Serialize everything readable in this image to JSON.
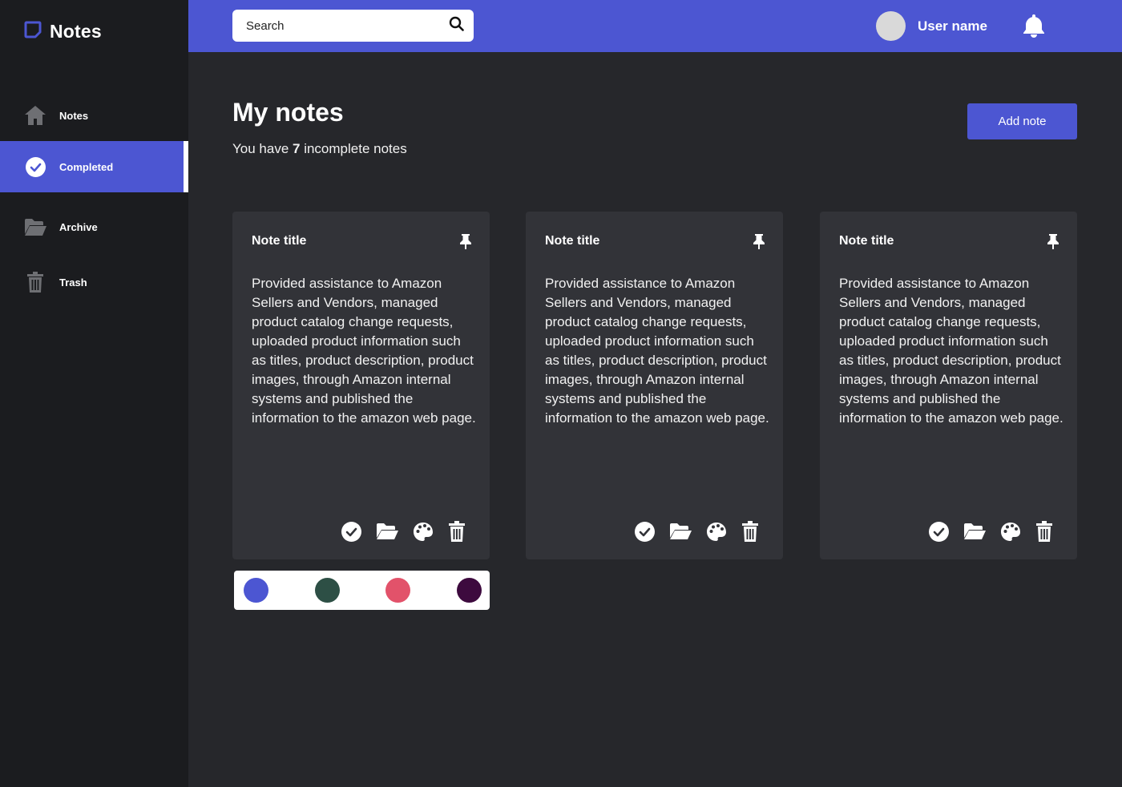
{
  "app": {
    "title": "Notes"
  },
  "sidebar": {
    "items": [
      {
        "label": "Notes",
        "icon": "home-icon"
      },
      {
        "label": "Completed",
        "icon": "check-circle-icon",
        "active": true
      },
      {
        "label": "Archive",
        "icon": "folder-open-icon"
      },
      {
        "label": "Trash",
        "icon": "trash-icon"
      }
    ]
  },
  "header": {
    "search_placeholder": "Search",
    "user_name": "User name"
  },
  "main": {
    "title": "My notes",
    "subtitle_prefix": "You have ",
    "incomplete_count": "7",
    "subtitle_suffix": " incomplete notes",
    "add_button": "Add note"
  },
  "notes": [
    {
      "title": "Note title",
      "body": "Provided assistance to Amazon Sellers and Vendors, managed product catalog change requests, uploaded product information such as titles, product description, product images, through Amazon internal systems and published the information to the amazon web page."
    },
    {
      "title": "Note title",
      "body": "Provided assistance to Amazon Sellers and Vendors, managed product catalog change requests, uploaded product information such as titles, product description, product images, through Amazon internal systems and published the information to the amazon web page."
    },
    {
      "title": "Note title",
      "body": "Provided assistance to Amazon Sellers and Vendors, managed product catalog change requests, uploaded product information such as titles, product description, product images, through Amazon internal systems and published the information to the amazon web page."
    }
  ],
  "palette": {
    "colors": [
      "#4c56d2",
      "#2d4f45",
      "#e2526a",
      "#3d0a3e"
    ]
  },
  "colors": {
    "accent": "#4c56d2",
    "sidebar_bg": "#1b1c1f",
    "page_bg": "#26272b",
    "card_bg": "#323338"
  }
}
